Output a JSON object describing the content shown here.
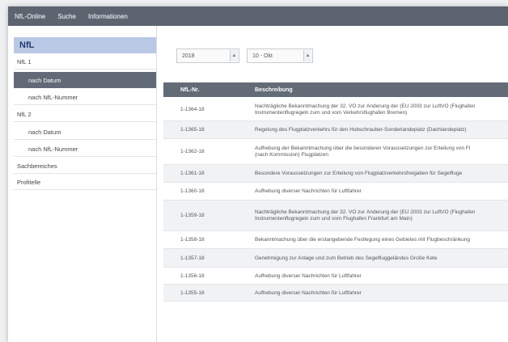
{
  "topnav": [
    "NfL-Online",
    "Suche",
    "Informationen"
  ],
  "sidebar": {
    "header": "NfL",
    "items": [
      {
        "label": "NfL 1",
        "level": 1,
        "active": false
      },
      {
        "label": "nach Datum",
        "level": 2,
        "active": true
      },
      {
        "label": "nach NfL-Nummer",
        "level": 2,
        "active": false
      },
      {
        "label": "NfL 2",
        "level": 1,
        "active": false
      },
      {
        "label": "nach Datum",
        "level": 2,
        "active": false
      },
      {
        "label": "nach NfL-Nummer",
        "level": 2,
        "active": false
      },
      {
        "label": "Sachbereiches",
        "level": 1,
        "active": false
      },
      {
        "label": "Profitelle",
        "level": 1,
        "active": false
      }
    ]
  },
  "filters": {
    "year": "2018",
    "month": "10 - Okt"
  },
  "table": {
    "columns": [
      "NfL-Nr.",
      "Beschreibung"
    ],
    "rows": [
      {
        "nr": "1-1364-18",
        "desc": [
          "Nachträgliche Bekanntmachung der 32. VO zur Änderung der (EU 2003 zur LuftVO (Flughafen",
          "Instrumentenflugregeln zum und vom Verkehrsflughafen Bremen)"
        ]
      },
      {
        "nr": "1-1365-18",
        "desc": [
          "Regelung des Flugplatzverkehrs für den Hubschrauber-Sonderlandeplatz (Dachlandeplatz)"
        ]
      },
      {
        "nr": "1-1362-18",
        "desc": [
          "Aufhebung der Bekanntmachung über die besonderen Voraussetzungen zur Erteilung von Fl",
          "(nach Kommission) Flugplatzen"
        ]
      },
      {
        "nr": "1-1361-18",
        "desc": [
          "Besondere Voraussetzungen zur Erteilung von Flugplatzverkehrsfreigaben für Segelfluge"
        ]
      },
      {
        "nr": "1-1360-18",
        "desc": [
          "Aufhebung diverser Nachrichten für Luftfahrer"
        ]
      },
      {
        "nr": "1-1359-18",
        "desc": [
          "Nachträgliche Bekanntmachung der 32. VO zur Änderung der (EU 2003 zur LuftVO (Flughafen",
          "Instrumentenflugregeln zum und vom Flughafen Frankfurt am Main)"
        ]
      },
      {
        "nr": "1-1358-18",
        "desc": [
          "Bekanntmachung über die erstangebende Festlegung eines Gebietes mit Flugbeschränkung"
        ]
      },
      {
        "nr": "1-1357-18",
        "desc": [
          "Genehmigung zur Anlage und zum Betrieb des Segelfluggeländes Große Kete"
        ]
      },
      {
        "nr": "1-1356-18",
        "desc": [
          "Aufhebung diverser Nachrichten für Luftfahrer"
        ]
      },
      {
        "nr": "1-1355-18",
        "desc": [
          "Aufhebung diverser Nachrichten für Luftfahrer"
        ]
      }
    ]
  }
}
